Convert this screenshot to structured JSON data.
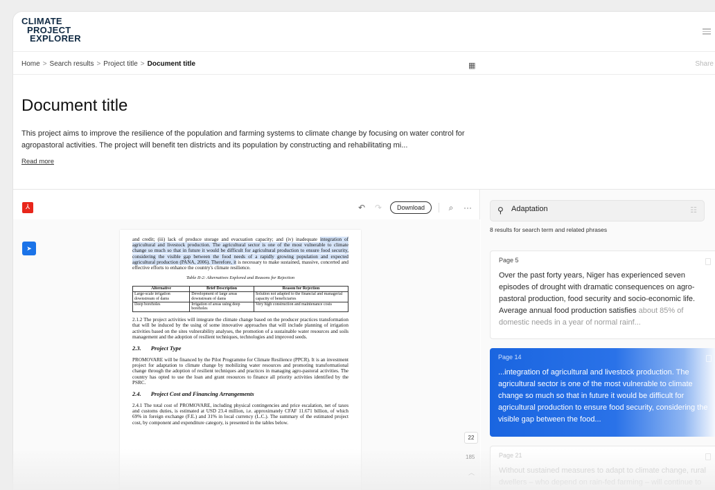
{
  "logo": {
    "line1": "CLIMATE",
    "line2": "PROJECT",
    "line3": "EXPLORER"
  },
  "breadcrumb": {
    "home": "Home",
    "search": "Search results",
    "project": "Project title",
    "current": "Document title",
    "sep": ">"
  },
  "share_label": "Share",
  "title": "Document title",
  "description": "This project aims to improve the resilience of the population and farming systems to climate change by focusing on water control for agropastoral activities. The project will benefit ten districts and its population by constructing and rehabilitating mi...",
  "read_more": "Read more",
  "toolbar": {
    "download": "Download",
    "undo": "↶",
    "redo": "↷",
    "search": "⌕",
    "more": "···"
  },
  "document": {
    "p1_pre": "and credit; (iii) lack of produce storage and evacuation capacity; and (iv) inadequate",
    "p1_hl": "integration of agricultural and livestock production. The agricultural sector is one of the most vulnerable to climate change so much so that in future it would be difficult for agricultural production to ensure food security, considering the visible gap between the food needs of a rapidly growing population and expected agricultural production (PANA, 2006). Therefore, it",
    "p1_post": "is necessary to make sustained, massive, concerted and effective efforts to enhance the country's climate resilience.",
    "table_caption": "Table II-2: Alternatives Explored and Reasons for Rejection",
    "table_headers": [
      "Alternative",
      "Brief Description",
      "Reason for Rejection"
    ],
    "table_rows": [
      [
        "Large-scale irrigation downstream of dams",
        "Development of large areas downstream of dams",
        "Solution not adapted to the financial and managerial capacity of beneficiaries"
      ],
      [
        "Deep boreholes",
        "Irrigation of areas using deep boreholes",
        "Very high construction and maintenance costs"
      ]
    ],
    "p2": "2.1.2 The project activities will integrate the climate change based on the producer practices transformation that will be induced by the using of some innovative approaches that will include planning of irrigation activities based on the sites vulnerability analyses, the promotion of a sustainable water resources and soils management and the adoption of resilient techniques, technologies and improved seeds.",
    "h1_num": "2.3.",
    "h1_text": "Project Type",
    "p3": "PROMOVARE will be financed by the Pilot Programme for Climate Resilience (PPCR). It is an investment project for adaptation to climate change by mobilizing water resources and promoting transformational change through the adoption of resilient techniques and practices in managing agro-pastoral activities. The country has opted to use the loan and grant resources to finance all priority activities identified by the PSRC.",
    "h2_num": "2.4.",
    "h2_text": "Project Cost and Financing Arrangements",
    "p4": "2.4.1 The total cost of PROMOVARE, including physical contingencies and price escalation, net of taxes and customs duties, is estimated at USD 23.4 million, i.e. approximately CFAF 11.671 billion, of which 69% in foreign exchange (F.E.) and 31% in local currency (L.C.). The summary of the estimated project cost, by component and expenditure category, is presented in the tables below."
  },
  "pagination": {
    "current": "22",
    "total": "185"
  },
  "search": {
    "value": "Adaptation",
    "results_count": "8 results for search term and related phrases"
  },
  "results": [
    {
      "page": "Page 5",
      "text_main": "Over the past forty years, Niger has experienced seven episodes of drought with dramatic consequences on agro-pastoral production, food security and socio-economic life. Average annual food production satisfies",
      "text_dim": " about 85% of domestic needs in a year of normal rainf..."
    },
    {
      "page": "Page 14",
      "text": "...integration of agricultural and livestock production. The agricultural sector is one of the most vulnerable to climate change so much so that in future it would be difficult for agricultural production to ensure food security, considering the visible gap between the food..."
    },
    {
      "page": "Page 21",
      "text": "Without sustained measures to adapt to climate change, rural dwellers – who depend on rain-fed farming – will continue to be weakened and will have no other opt..."
    }
  ],
  "colors": {
    "accent": "#1a73e8",
    "pdf_red": "#e8261b",
    "logo": "#102a43"
  }
}
